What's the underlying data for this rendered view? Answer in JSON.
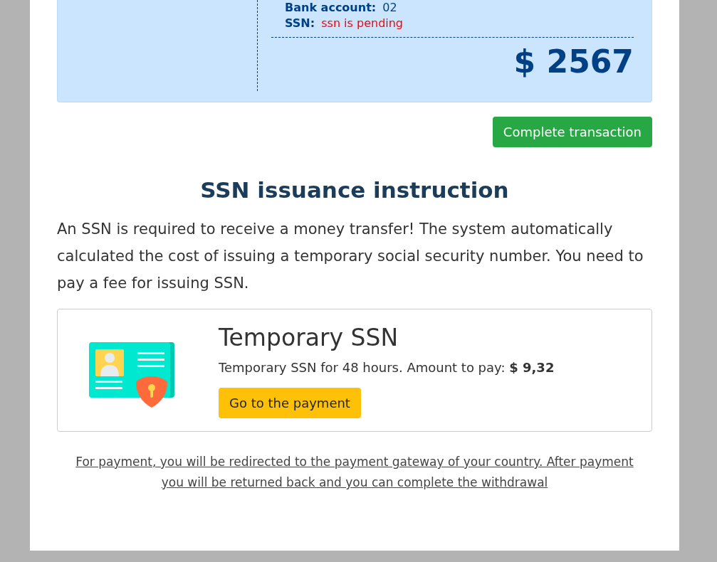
{
  "summary": {
    "fields": [
      {
        "label": "Bank account:",
        "value": "02",
        "kind": "normal"
      },
      {
        "label": "SSN:",
        "value": "ssn is pending",
        "kind": "pending"
      }
    ],
    "total": "$ 2567"
  },
  "complete_button": "Complete transaction",
  "instruction": {
    "title": "SSN issuance instruction",
    "text": "An SSN is required to receive a money transfer! The system automatically calculated the cost of issuing a temporary social security number. You need to pay a fee for issuing SSN."
  },
  "offer": {
    "title": "Temporary SSN",
    "text": "Temporary SSN for 48 hours. Amount to pay: **$ 9,32**",
    "button": "Go to the payment"
  },
  "note_link": "For payment, you will be redirected to the payment gateway of your country. After payment you will be returned back and you can complete the withdrawal"
}
